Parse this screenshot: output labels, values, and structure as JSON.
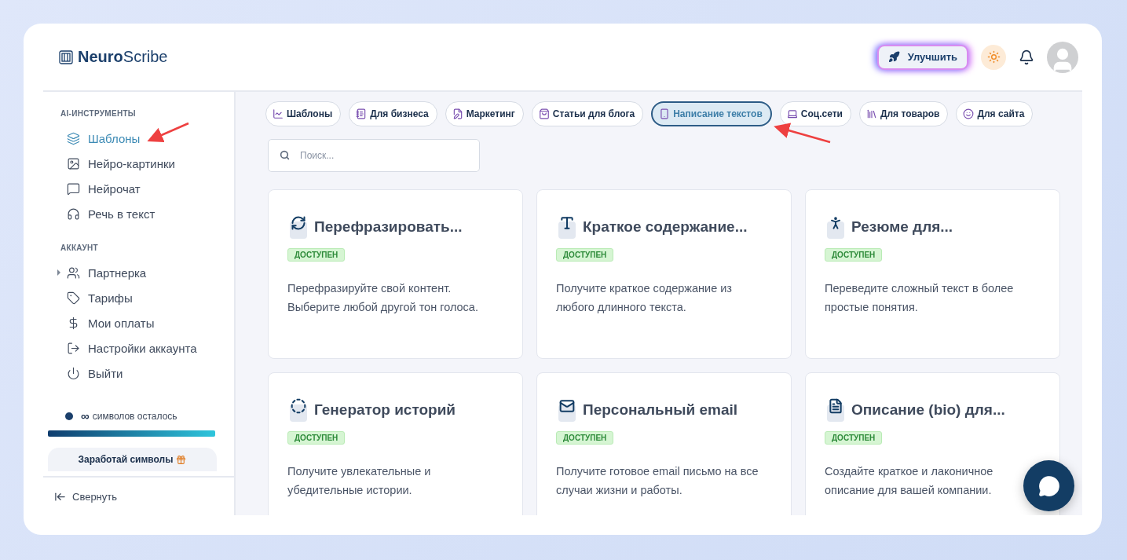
{
  "brand": {
    "bold": "Neuro",
    "light": "Scribe"
  },
  "header": {
    "upgrade_button": "Улучшить"
  },
  "sidebar": {
    "sections": [
      {
        "title": "AI-ИНСТРУМЕНТЫ",
        "items": [
          {
            "label": "Шаблоны",
            "selected": true
          },
          {
            "label": "Нейро-картинки",
            "selected": false
          },
          {
            "label": "Нейрочат",
            "selected": false
          },
          {
            "label": "Речь в текст",
            "selected": false
          }
        ]
      },
      {
        "title": "АККАУНТ",
        "items": [
          {
            "label": "Партнерка",
            "selected": false,
            "expanded": false
          },
          {
            "label": "Тарифы",
            "selected": false
          },
          {
            "label": "Мои оплаты",
            "selected": false
          },
          {
            "label": "Настройки аккаунта",
            "selected": false
          },
          {
            "label": "Выйти",
            "selected": false
          }
        ]
      }
    ],
    "credits": {
      "infinity": "∞",
      "label": "символов осталось",
      "level": 1
    },
    "earn_button": "Заработай символы",
    "collapse": "Свернуть"
  },
  "categories": [
    {
      "label": "Шаблоны",
      "selected": false
    },
    {
      "label": "Для бизнеса",
      "selected": false
    },
    {
      "label": "Маркетинг",
      "selected": false
    },
    {
      "label": "Статьи для блога",
      "selected": false
    },
    {
      "label": "Написание текстов",
      "selected": true
    },
    {
      "label": "Соц.сети",
      "selected": false
    },
    {
      "label": "Для товаров",
      "selected": false
    },
    {
      "label": "Для сайта",
      "selected": false
    }
  ],
  "search": {
    "placeholder": "Поиск..."
  },
  "templates": [
    {
      "title": "Перефразировать...",
      "badge": "ДОСТУПЕН",
      "description": "Перефразируйте свой контент. Выберите любой другой тон голоса."
    },
    {
      "title": "Краткое содержание...",
      "badge": "ДОСТУПЕН",
      "description": "Получите краткое содержание из любого длинного текста."
    },
    {
      "title": "Резюме для...",
      "badge": "ДОСТУПЕН",
      "description": "Переведите сложный текст в более простые понятия."
    },
    {
      "title": "Генератор историй",
      "badge": "ДОСТУПЕН",
      "description": "Получите увлекательные и убедительные истории."
    },
    {
      "title": "Персональный email",
      "badge": "ДОСТУПЕН",
      "description": "Получите готовое email письмо на все случаи жизни и работы."
    },
    {
      "title": "Описание (bio) для...",
      "badge": "ДОСТУПЕН",
      "description": "Создайте краткое и лаконичное описание для вашей компании."
    }
  ]
}
